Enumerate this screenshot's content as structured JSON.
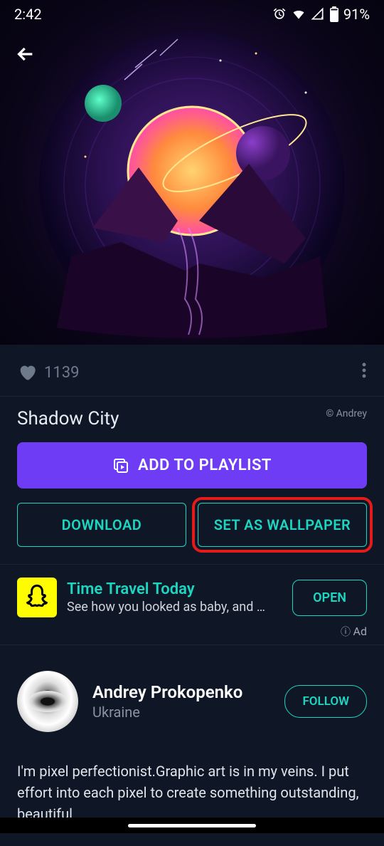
{
  "status": {
    "time": "2:42",
    "battery": "91%"
  },
  "likes": {
    "count": "1139"
  },
  "wallpaper": {
    "title": "Shadow City",
    "copyright": "© Andrey"
  },
  "buttons": {
    "add_playlist": "ADD TO PLAYLIST",
    "download": "DOWNLOAD",
    "set_wallpaper": "SET AS WALLPAPER"
  },
  "ad": {
    "title": "Time Travel Today",
    "subtitle": "See how you looked as baby, and how y…",
    "cta": "OPEN",
    "label": "Ad"
  },
  "author": {
    "name": "Andrey Prokopenko",
    "location": "Ukraine",
    "follow": "FOLLOW",
    "bio": "I'm pixel perfectionist.Graphic art is in my veins. I put effort into each pixel to create something outstanding, beautiful"
  }
}
